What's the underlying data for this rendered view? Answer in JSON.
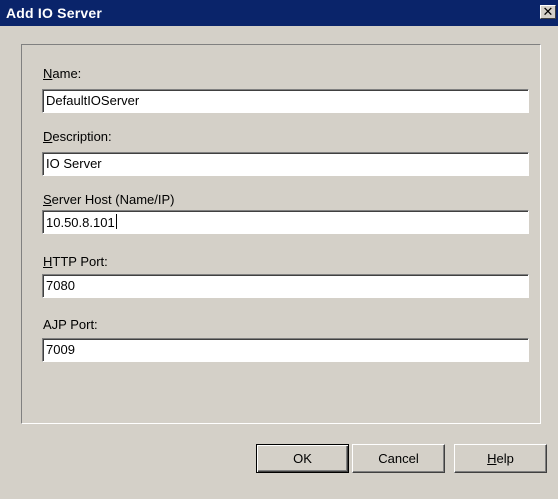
{
  "window": {
    "title": "Add IO Server",
    "close_glyph": "✕"
  },
  "fields": {
    "name": {
      "label_accel": "N",
      "label_rest": "ame:",
      "value": "DefaultIOServer"
    },
    "description": {
      "label_accel": "D",
      "label_rest": "escription:",
      "value": "IO Server"
    },
    "server_host": {
      "label_accel": "S",
      "label_rest": "erver Host (Name/IP)",
      "value": "10.50.8.101"
    },
    "http_port": {
      "label_accel": "H",
      "label_rest": "TTP Port:",
      "value": "7080"
    },
    "ajp_port": {
      "label_accel": "",
      "label_rest": "AJP Port:",
      "value": "7009"
    }
  },
  "buttons": {
    "ok": {
      "label_accel": "",
      "label_rest": "OK"
    },
    "cancel": {
      "label_accel": "",
      "label_rest": "Cancel"
    },
    "help": {
      "label_accel": "H",
      "label_rest": "elp"
    }
  },
  "icons": {
    "close": "close-icon"
  },
  "colors": {
    "title_bar": "#0a246a",
    "dialog_face": "#d4d0c8",
    "input_background": "#ffffff"
  }
}
